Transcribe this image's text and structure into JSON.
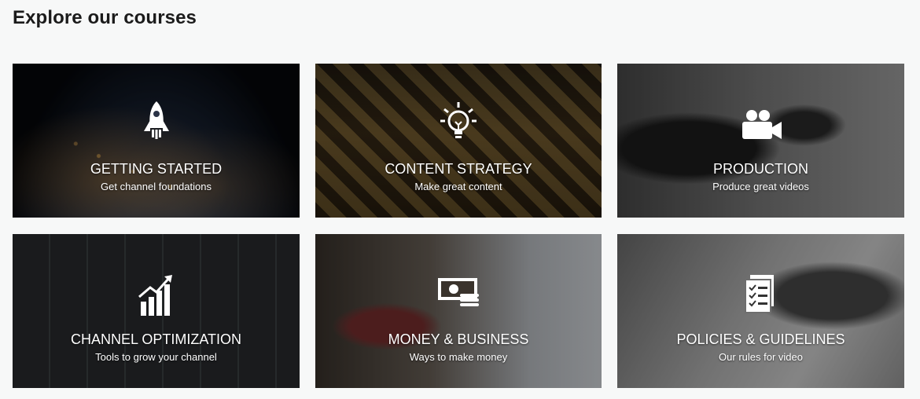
{
  "heading": "Explore our courses",
  "cards": [
    {
      "title": "GETTING STARTED",
      "subtitle": "Get channel foundations",
      "icon": "rocket-icon"
    },
    {
      "title": "CONTENT STRATEGY",
      "subtitle": "Make great content",
      "icon": "lightbulb-icon"
    },
    {
      "title": "PRODUCTION",
      "subtitle": "Produce great videos",
      "icon": "video-camera-icon"
    },
    {
      "title": "CHANNEL OPTIMIZATION",
      "subtitle": "Tools to grow your channel",
      "icon": "growth-chart-icon"
    },
    {
      "title": "MONEY & BUSINESS",
      "subtitle": "Ways to make money",
      "icon": "money-icon"
    },
    {
      "title": "POLICIES & GUIDELINES",
      "subtitle": "Our rules for video",
      "icon": "checklist-icon"
    }
  ]
}
